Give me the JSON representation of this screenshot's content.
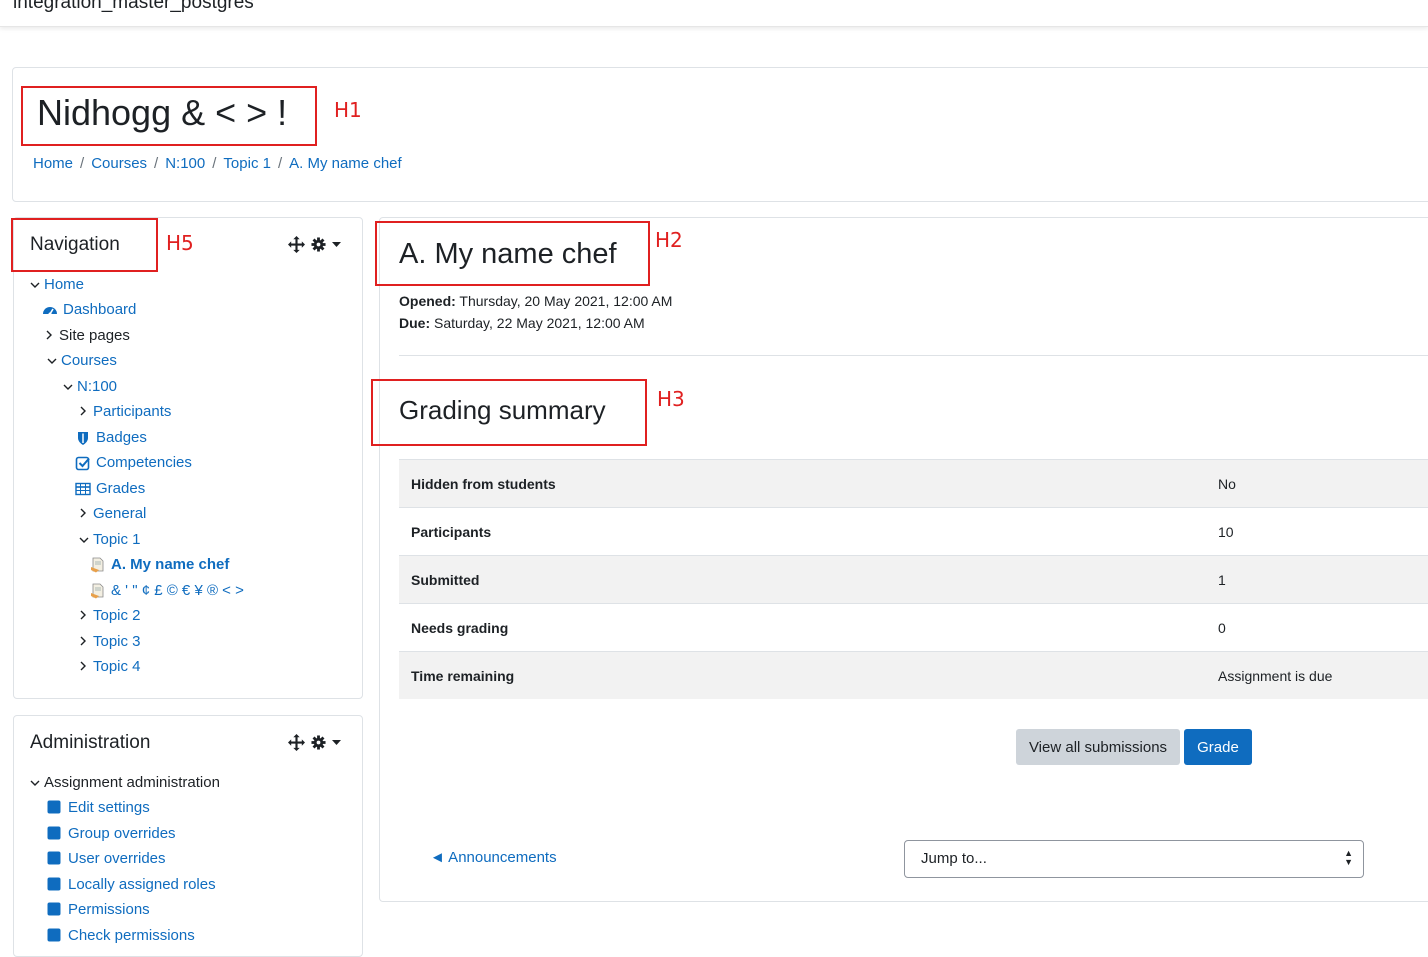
{
  "site": {
    "name": "integration_master_postgres"
  },
  "header": {
    "title": "Nidhogg & < > !",
    "breadcrumb": [
      "Home",
      "Courses",
      "N:100",
      "Topic 1",
      "A. My name chef"
    ],
    "breadcrumb_separator": "/"
  },
  "annotations": {
    "h1": "H1",
    "h2": "H2",
    "h3": "H3",
    "h5": "H5",
    "color": "#e02020"
  },
  "navigation": {
    "title": "Navigation",
    "items": [
      {
        "label": "Home",
        "icon": "chevron-down-icon"
      },
      {
        "label": "Dashboard",
        "icon": "dashboard-icon"
      },
      {
        "label": "Site pages",
        "icon": "chevron-right-icon"
      },
      {
        "label": "Courses",
        "icon": "chevron-down-icon"
      },
      {
        "label": "N:100",
        "icon": "chevron-down-icon"
      },
      {
        "label": "Participants",
        "icon": "chevron-right-icon"
      },
      {
        "label": "Badges",
        "icon": "shield-icon"
      },
      {
        "label": "Competencies",
        "icon": "check-square-icon"
      },
      {
        "label": "Grades",
        "icon": "table-icon"
      },
      {
        "label": "General",
        "icon": "chevron-right-icon"
      },
      {
        "label": "Topic 1",
        "icon": "chevron-down-icon"
      },
      {
        "label": "A. My name chef",
        "icon": "assignment-icon"
      },
      {
        "label": "& ' \" ¢ £ © € ¥ ® < >",
        "icon": "assignment-icon"
      },
      {
        "label": "Topic 2",
        "icon": "chevron-right-icon"
      },
      {
        "label": "Topic 3",
        "icon": "chevron-right-icon"
      },
      {
        "label": "Topic 4",
        "icon": "chevron-right-icon"
      }
    ]
  },
  "administration": {
    "title": "Administration",
    "section": "Assignment administration",
    "items": [
      "Edit settings",
      "Group overrides",
      "User overrides",
      "Locally assigned roles",
      "Permissions",
      "Check permissions"
    ]
  },
  "activity": {
    "title": "A. My name chef",
    "opened_label": "Opened:",
    "opened_value": "Thursday, 20 May 2021, 12:00 AM",
    "due_label": "Due:",
    "due_value": "Saturday, 22 May 2021, 12:00 AM"
  },
  "grading": {
    "title": "Grading summary",
    "rows": [
      {
        "label": "Hidden from students",
        "value": "No"
      },
      {
        "label": "Participants",
        "value": "10"
      },
      {
        "label": "Submitted",
        "value": "1"
      },
      {
        "label": "Needs grading",
        "value": "0"
      },
      {
        "label": "Time remaining",
        "value": "Assignment is due"
      }
    ],
    "view_all_label": "View all submissions",
    "grade_label": "Grade"
  },
  "footer_nav": {
    "prev_label": "◄ Announcements",
    "jump_placeholder": "Jump to..."
  },
  "colors": {
    "link": "#0f6cbf",
    "primary": "#0f6cbf",
    "secondary": "#ced4da",
    "annotation": "#e02020"
  }
}
